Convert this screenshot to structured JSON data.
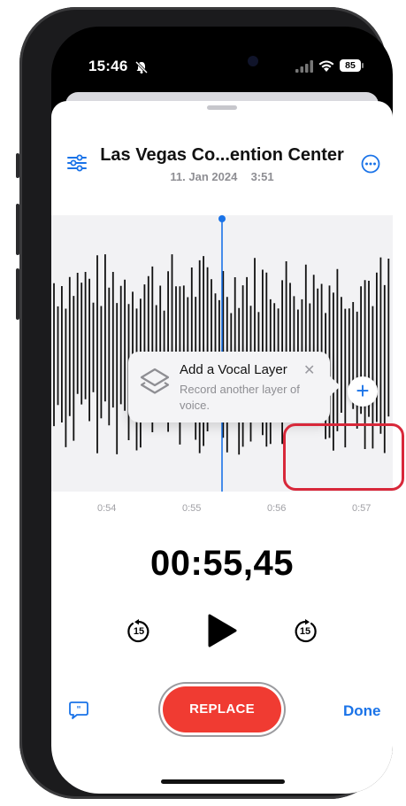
{
  "status_bar": {
    "time": "15:46",
    "battery": "85"
  },
  "recording": {
    "title": "Las Vegas Co...ention Center",
    "date": "11. Jan 2024",
    "duration": "3:51"
  },
  "timeline": {
    "ticks": [
      "0:54",
      "0:55",
      "0:56",
      "0:57"
    ]
  },
  "popup": {
    "title": "Add a Vocal Layer",
    "subtitle": "Record another layer of voice."
  },
  "player": {
    "elapsed": "00:55,45",
    "skip_back_seconds": "15",
    "skip_forward_seconds": "15"
  },
  "footer": {
    "replace_label": "REPLACE",
    "done_label": "Done"
  },
  "colors": {
    "accent": "#1a73e8",
    "record": "#f03b32",
    "highlight": "#d8283a"
  },
  "icons": [
    "edit-settings-icon",
    "more-icon",
    "layers-icon",
    "close-icon",
    "plus-icon",
    "skip-back-15-icon",
    "play-icon",
    "skip-forward-15-icon",
    "transcript-icon"
  ]
}
